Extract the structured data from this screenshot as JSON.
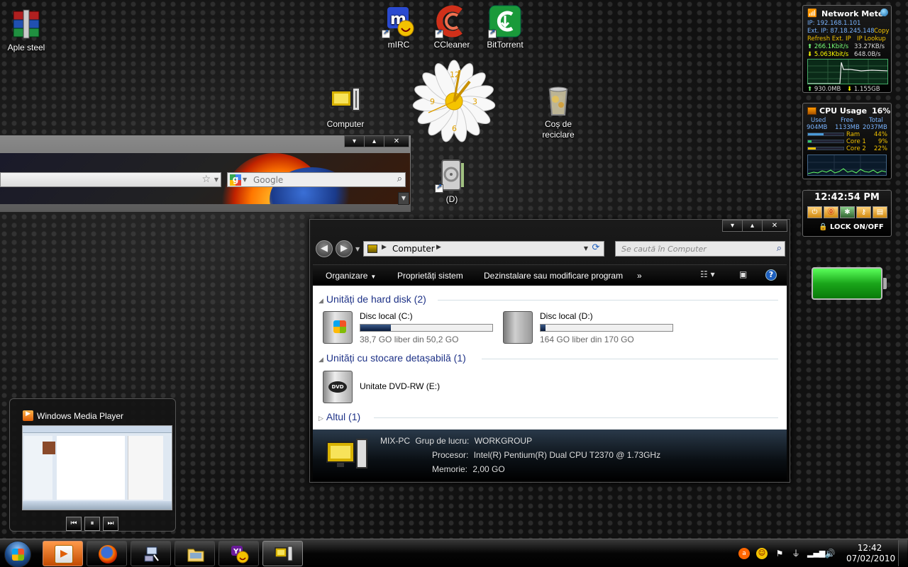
{
  "desktop_icons": {
    "aple_steel": "Aple steel",
    "mirc": "mIRC",
    "ccleaner": "CCleaner",
    "bittorrent": "BitTorrent",
    "computer": "Computer",
    "recycle": "Coș de reciclare",
    "drive_d": "(D)"
  },
  "firefox": {
    "search_placeholder": "Google"
  },
  "explorer": {
    "address": "Computer",
    "search_placeholder": "Se caută în Computer",
    "toolbar": {
      "organize": "Organizare",
      "system_props": "Proprietăți sistem",
      "uninstall": "Dezinstalare sau modificare program",
      "more": "»"
    },
    "groups": {
      "hdd": "Unități de hard disk (2)",
      "removable": "Unități cu stocare detașabilă (1)",
      "other": "Altul (1)"
    },
    "drives": [
      {
        "name": "Disc local (C:)",
        "size": "38,7 GO liber din 50,2 GO",
        "used_fraction": 0.23
      },
      {
        "name": "Disc local (D:)",
        "size": "164 GO liber din 170 GO",
        "used_fraction": 0.04
      }
    ],
    "dvd": "Unitate DVD-RW (E:)",
    "details": {
      "pc_name": "MIX-PC",
      "workgroup_label": "Grup de lucru:",
      "workgroup": "WORKGROUP",
      "cpu_label": "Procesor:",
      "cpu": "Intel(R) Pentium(R) Dual  CPU  T2370  @ 1.73GHz",
      "mem_label": "Memorie:",
      "mem": "2,00 GO"
    }
  },
  "netmeter": {
    "title": "Network Meter",
    "ip": "IP: 192.168.1.101",
    "ext_ip": "Ext. IP: 87.18.245.148",
    "copy": "Copy",
    "refresh": "Refresh Ext. IP",
    "lookup": "IP Lookup",
    "up_speed": "266.1Kbit/s",
    "up_rate": "33.27KB/s",
    "down_speed": "5.063Kbit/s",
    "down_rate": "648.0B/s",
    "up_total": "930.0MB",
    "down_total": "1.155GB"
  },
  "cpu": {
    "title": "CPU Usage",
    "percent": "16%",
    "used_label": "Used",
    "free_label": "Free",
    "total_label": "Total",
    "used": "904MB",
    "free": "1133MB",
    "total": "2037MB",
    "rows": [
      {
        "label": "Ram",
        "value": "44%",
        "fraction": 0.44
      },
      {
        "label": "Core 1",
        "value": "9%",
        "fraction": 0.09
      },
      {
        "label": "Core 2",
        "value": "22%",
        "fraction": 0.22
      }
    ]
  },
  "clock_gadget": {
    "time": "12:42:54 PM",
    "lock": "LOCK ON/OFF"
  },
  "wmp": {
    "title": "Windows Media Player"
  },
  "tray": {
    "time": "12:42",
    "date": "07/02/2010"
  },
  "colors": {
    "accent_blue": "#1e3287",
    "battery_green": "#1aa61a"
  }
}
